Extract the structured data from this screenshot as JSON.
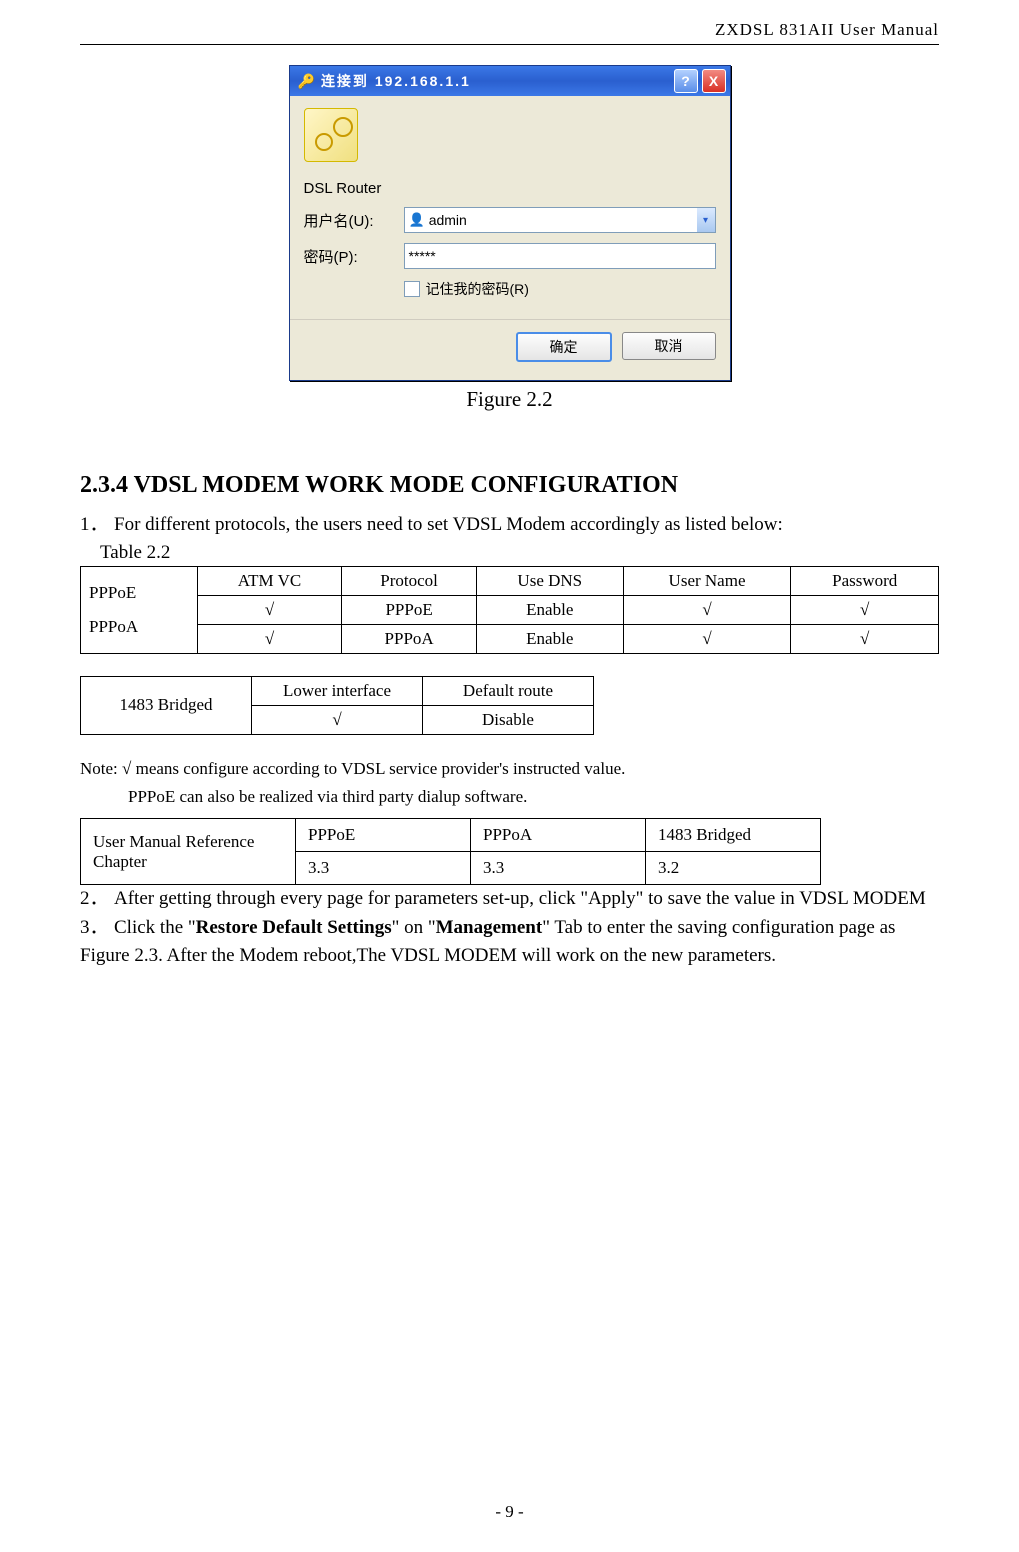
{
  "doc": {
    "header": "ZXDSL 831AII User Manual",
    "footer": "- 9 -"
  },
  "dialog": {
    "title": "连接到 192.168.1.1",
    "subtitle": "DSL Router",
    "user_label": "用户名(U):",
    "user_value": "admin",
    "pass_label": "密码(P):",
    "pass_value": "*****",
    "remember": "记住我的密码(R)",
    "ok": "确定",
    "cancel": "取消",
    "help": "?",
    "close": "X"
  },
  "figure_caption": "Figure 2.2",
  "section_title": "2.3.4 VDSL MODEM WORK MODE CONFIGURATION",
  "step1": {
    "num": "1．",
    "text": "For different protocols, the users need to set VDSL Modem accordingly as listed below:"
  },
  "table2_label": "Table 2.2",
  "table1": {
    "rowhead": "PPPoE\nPPPoA",
    "headers": [
      "ATM VC",
      "Protocol",
      "Use DNS",
      "User Name",
      "Password"
    ],
    "rows": [
      [
        "√",
        "PPPoE",
        "Enable",
        "√",
        "√"
      ],
      [
        "√",
        "PPPoA",
        "Enable",
        "√",
        "√"
      ]
    ]
  },
  "table2": {
    "rowhead": "1483 Bridged",
    "headers": [
      "Lower interface",
      "Default route"
    ],
    "rows": [
      [
        "√",
        "Disable"
      ]
    ]
  },
  "note_line1": "Note:  √  means configure according to VDSL service provider's instructed value.",
  "note_line2": "PPPoE can also be realized via third party dialup software.",
  "table3": {
    "rowhead": "User Manual Reference Chapter",
    "headers": [
      "PPPoE",
      "PPPoA",
      "1483 Bridged"
    ],
    "rows": [
      [
        "3.3",
        "3.3",
        "3.2"
      ]
    ]
  },
  "step2": {
    "num": "2．",
    "text": "After getting through every page for parameters set-up, click \"Apply\" to save the value in VDSL MODEM"
  },
  "step3": {
    "num": "3．",
    "text_a": "Click the \"",
    "bold_a": "Restore Default Settings",
    "text_b": "\" on \"",
    "bold_b": "Management",
    "text_c": "\" Tab to enter the saving configuration page as Figure 2.3. After the Modem reboot,The VDSL MODEM will work on the new parameters."
  }
}
